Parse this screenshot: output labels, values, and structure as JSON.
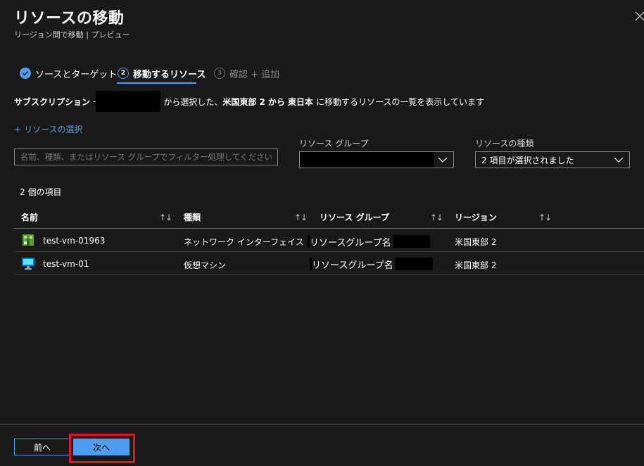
{
  "header": {
    "title": "リソースの移動",
    "subtitle": "リージョン間で移動 | プレビュー",
    "close_icon": "close-icon"
  },
  "tabs": [
    {
      "number": "",
      "label": "ソースとターゲット",
      "state": "completed",
      "icon": "check-circle-icon"
    },
    {
      "number": "2",
      "label": "移動するリソース",
      "state": "active"
    },
    {
      "number": "3",
      "label": "確認 + 追加",
      "state": "disabled"
    }
  ],
  "description": {
    "prefix": "サブスクリプション",
    "dash": "-",
    "middle": "から選択した、",
    "source_region": "米国東部 2",
    "from_word": "から",
    "target_region": "東日本",
    "suffix": "に移動するリソースの一覧を表示しています"
  },
  "select_resources": {
    "plus": "+",
    "label": "リソースの選択"
  },
  "filter": {
    "placeholder": "名前、種類、またはリソース グループでフィルター処理してください",
    "value": ""
  },
  "resource_group_filter": {
    "label": "リソース グループ",
    "value": ""
  },
  "resource_type_filter": {
    "label": "リソースの種類",
    "value": "2 項目が選択されました"
  },
  "item_count": "2 個の項目",
  "table": {
    "columns": [
      "名前",
      "種類",
      "リソース グループ",
      "リージョン"
    ],
    "sort_glyph": "↑↓",
    "rows": [
      {
        "icon": "network-interface-icon",
        "name": "test-vm-01963",
        "type": "ネットワーク インターフェイス",
        "resource_group": "リソースグループ名",
        "region": "米国東部 2"
      },
      {
        "icon": "virtual-machine-icon",
        "name": "test-vm-01",
        "type": "仮想マシン",
        "resource_group": "リソースグループ名",
        "region": "米国東部 2"
      }
    ]
  },
  "footer": {
    "prev_label": "前へ",
    "next_label": "次へ"
  },
  "colors": {
    "accent": "#4f9cf0",
    "background": "#1b1a19",
    "highlight": "#e81123"
  }
}
